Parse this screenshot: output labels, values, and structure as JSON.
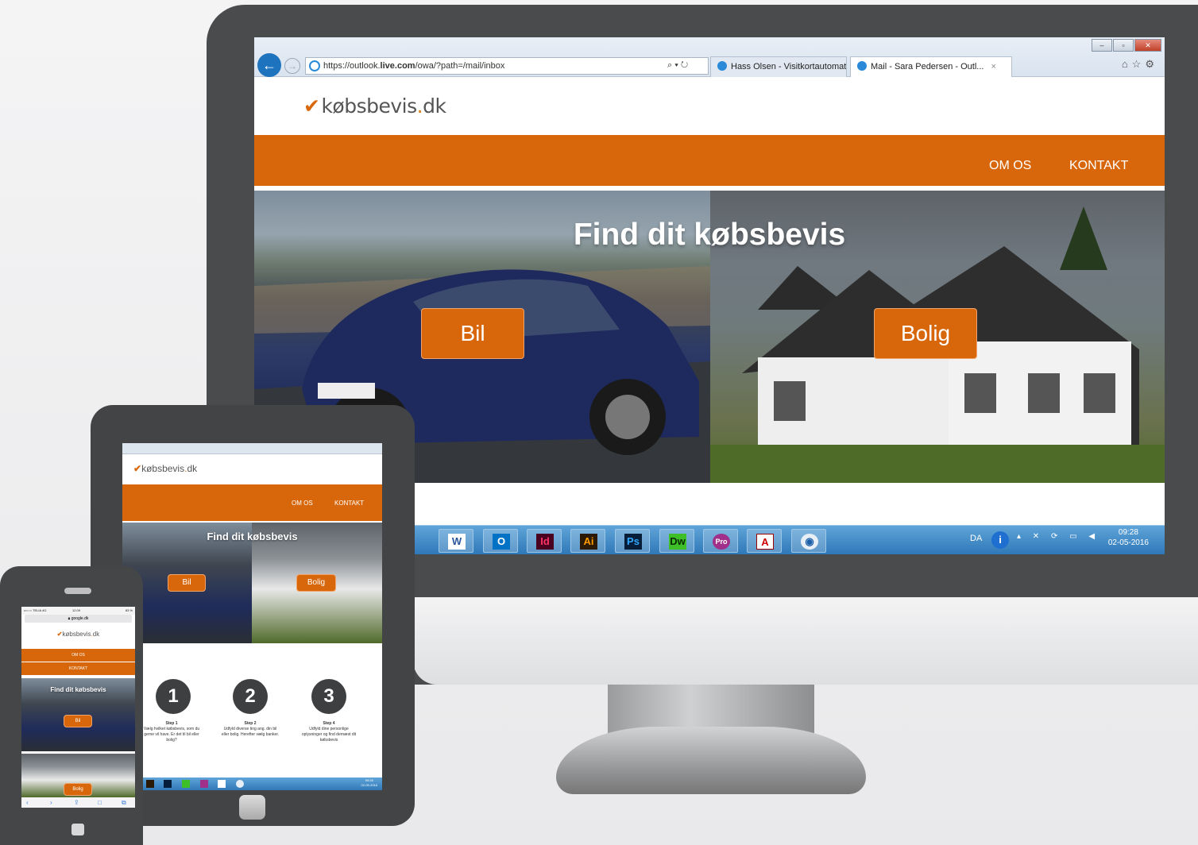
{
  "desktop": {
    "browser": {
      "address_prefix": "https://outlook.",
      "address_domain": "live.com",
      "address_path": "/owa/?path=/mail/inbox",
      "search_glyph": "⌕ ▾ ↻",
      "tab1": "Hass Olsen - Visitkortautomat",
      "tab2": "Mail - Sara Pedersen - Outl...",
      "tab2_close": "×",
      "right_icons": "⌂☆⚙",
      "win_min": "–",
      "win_max": "▫",
      "win_close": "✕"
    },
    "site": {
      "logo_check": "✔",
      "logo_main": "købsbevis",
      "logo_dot": ".",
      "logo_tld": "dk",
      "nav_about": "OM OS",
      "nav_contact": "KONTAKT",
      "hero_title": "Find dit købsbevis",
      "btn_car": "Bil",
      "btn_house": "Bolig"
    },
    "taskbar": {
      "apps": [
        "W",
        "O",
        "Id",
        "Ai",
        "Ps",
        "Dw",
        "Pro",
        "A",
        "◉"
      ],
      "lang": "DA",
      "time": "09:28",
      "date": "02-05-2016"
    }
  },
  "tablet": {
    "site": {
      "logo": "købsbevis",
      "logo_dot": ".",
      "logo_tld": "dk",
      "nav_about": "OM OS",
      "nav_contact": "KONTAKT",
      "hero_title": "Find dit købsbevis",
      "btn_car": "Bil",
      "btn_house": "Bolig"
    },
    "steps": [
      {
        "num": "1",
        "title": "Step 1",
        "text": "Vælg hvilket købsbevis, som du gerne vil have. Er det til bil eller bolig?"
      },
      {
        "num": "2",
        "title": "Step 2",
        "text": "Udfyld diverse ting ang. din bil eller bolig. Herefter vælg banker."
      },
      {
        "num": "3",
        "title": "Step 4",
        "text": "Udfyld dine personlige oplysninger og find dernæst dit købsbevis"
      }
    ],
    "taskbar_time": "09:28",
    "taskbar_date": "02-05-2016"
  },
  "phone": {
    "status_carrier": "••○○○ TELIA  4G",
    "status_time": "12.09",
    "status_battery": "83 %",
    "url": "google.dk",
    "site": {
      "logo": "købsbevis",
      "logo_dot": ".",
      "logo_tld": "dk",
      "nav_about": "OM OS",
      "nav_contact": "KONTAKT",
      "hero_title": "Find dit købsbevis",
      "btn_car": "Bil",
      "btn_house": "Bolig"
    },
    "bottom_icons": [
      "‹",
      "›",
      "⇪",
      "□",
      "⧉"
    ]
  },
  "colors": {
    "brand_orange": "#d7670a",
    "device_dark": "#4a4b4d"
  }
}
